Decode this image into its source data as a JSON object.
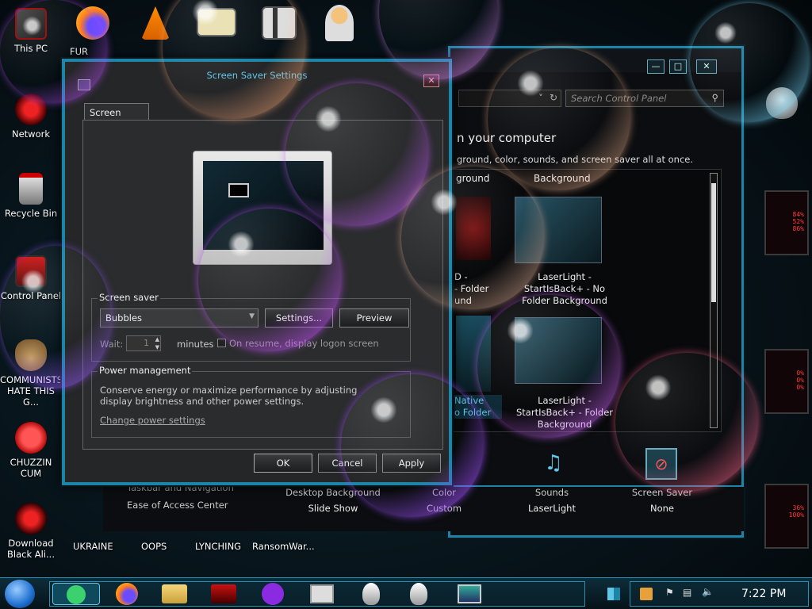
{
  "desktop": {
    "icons": [
      {
        "label": "This PC"
      },
      {
        "label": "Network"
      },
      {
        "label": "Recycle Bin"
      },
      {
        "label": "Control Panel"
      },
      {
        "label": "COMMUNISTS HATE THIS G..."
      },
      {
        "label": "CHUZZIN CUM"
      },
      {
        "label": "Download Black Ali..."
      }
    ],
    "top_fur": "FUR",
    "bottom_row": [
      "UKRAINE",
      "OOPS",
      "LYNCHING",
      "RansomWar..."
    ]
  },
  "control_panel": {
    "search_placeholder": "Search Control Panel",
    "heading": "n your computer",
    "subheading": "ground, color, sounds, and screen saver all at once.",
    "theme_col1_header": "ground",
    "theme_col2_header": "Background",
    "themes": [
      {
        "label": "D -\n- Folder\nund"
      },
      {
        "label": "LaserLight -\nStartIsBack+ - No\nFolder Background"
      },
      {
        "label": "Native\no Folder"
      },
      {
        "label": "LaserLight -\nStartIsBack+ - Folder\nBackground"
      }
    ],
    "bottom_items": [
      {
        "title": "Desktop Background",
        "value": "Slide Show"
      },
      {
        "title": "Color",
        "value": "Custom"
      },
      {
        "title": "Sounds",
        "value": "LaserLight"
      },
      {
        "title": "Screen Saver",
        "value": "None"
      }
    ],
    "left_links": [
      "Taskbar and Navigation",
      "Ease of Access Center"
    ]
  },
  "dialog": {
    "title": "Screen Saver Settings",
    "tab": "Screen Saver",
    "screen_saver_group": "Screen saver",
    "selected_saver": "Bubbles",
    "settings_button": "Settings...",
    "preview_button": "Preview",
    "wait_label": "Wait:",
    "wait_value": "1",
    "minutes_label": "minutes",
    "resume_label": "On resume, display logon screen",
    "power_group": "Power management",
    "power_text": "Conserve energy or maximize performance by adjusting display brightness and other power settings.",
    "power_link": "Change power settings",
    "ok_button": "OK",
    "cancel_button": "Cancel",
    "apply_button": "Apply"
  },
  "deco": {
    "readouts": [
      "84%",
      "52%",
      "86%",
      "0%",
      "0%",
      "0%",
      "36%",
      "100%"
    ]
  },
  "taskbar": {
    "clock": "7:22 PM"
  },
  "colors": {
    "accent": "#1c84a6",
    "title_text": "#5fc7e8",
    "red_readout": "#ff3a3a"
  }
}
